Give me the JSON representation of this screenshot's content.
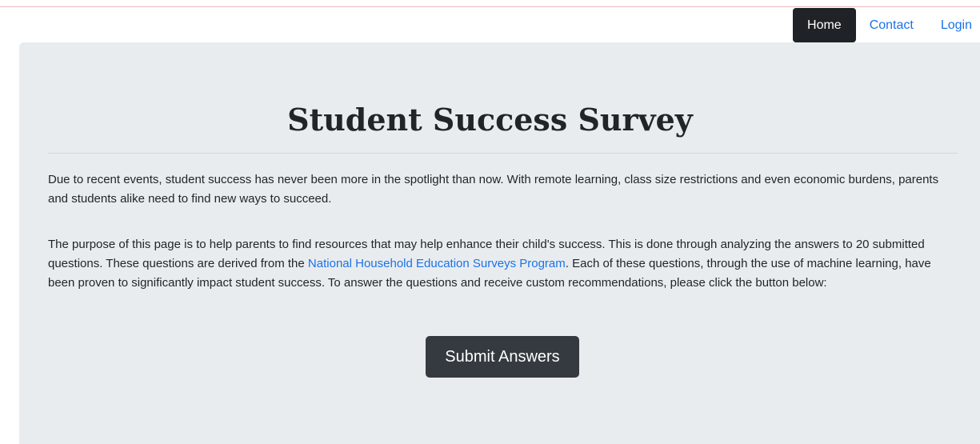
{
  "nav": {
    "items": [
      {
        "label": "Home",
        "active": true
      },
      {
        "label": "Contact",
        "active": false
      },
      {
        "label": "Login",
        "active": false
      }
    ]
  },
  "main": {
    "title": "Student Success Survey",
    "paragraph1": "Due to recent events, student success has never been more in the spotlight than now. With remote learning, class size restrictions and even economic burdens, parents and students alike need to find new ways to succeed.",
    "paragraph2_before_link": "The purpose of this page is to help parents to find resources that may help enhance their child's success. This is done through analyzing the answers to 20 submitted questions. These questions are derived from the ",
    "paragraph2_link": "National Household Education Surveys Program",
    "paragraph2_after_link": ". Each of these questions, through the use of machine learning, have been proven to significantly impact student success. To answer the questions and receive custom recommendations, please click the button below:",
    "submit_label": "Submit Answers"
  },
  "colors": {
    "link": "#1a73e8",
    "nav_active_bg": "#1f2226",
    "button_bg": "#343a40",
    "panel_bg": "#e9ecef"
  }
}
